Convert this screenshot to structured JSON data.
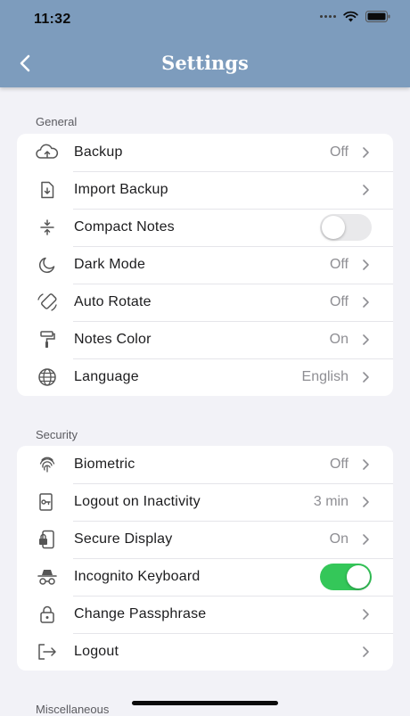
{
  "status_bar": {
    "time": "11:32"
  },
  "header": {
    "title": "Settings"
  },
  "sections": [
    {
      "title": "General",
      "rows": [
        {
          "label": "Backup",
          "value": "Off",
          "icon": "cloud-upload-icon"
        },
        {
          "label": "Import Backup",
          "value": "",
          "icon": "file-import-icon"
        },
        {
          "label": "Compact Notes",
          "toggle": false,
          "icon": "compact-icon"
        },
        {
          "label": "Dark Mode",
          "value": "Off",
          "icon": "moon-icon"
        },
        {
          "label": "Auto Rotate",
          "value": "Off",
          "icon": "rotate-icon"
        },
        {
          "label": "Notes Color",
          "value": "On",
          "icon": "paint-roller-icon"
        },
        {
          "label": "Language",
          "value": "English",
          "icon": "globe-icon"
        }
      ]
    },
    {
      "title": "Security",
      "rows": [
        {
          "label": "Biometric",
          "value": "Off",
          "icon": "fingerprint-icon"
        },
        {
          "label": "Logout on Inactivity",
          "value": "3 min",
          "icon": "timer-key-icon"
        },
        {
          "label": "Secure Display",
          "value": "On",
          "icon": "phone-lock-icon"
        },
        {
          "label": "Incognito Keyboard",
          "toggle": true,
          "icon": "incognito-icon"
        },
        {
          "label": "Change Passphrase",
          "value": "",
          "icon": "lock-icon"
        },
        {
          "label": "Logout",
          "value": "",
          "icon": "logout-icon"
        }
      ]
    },
    {
      "title": "Miscellaneous"
    }
  ],
  "colors": {
    "header": "#7d9cbd",
    "toggle_on": "#34c759",
    "background": "#f2f2f7"
  }
}
